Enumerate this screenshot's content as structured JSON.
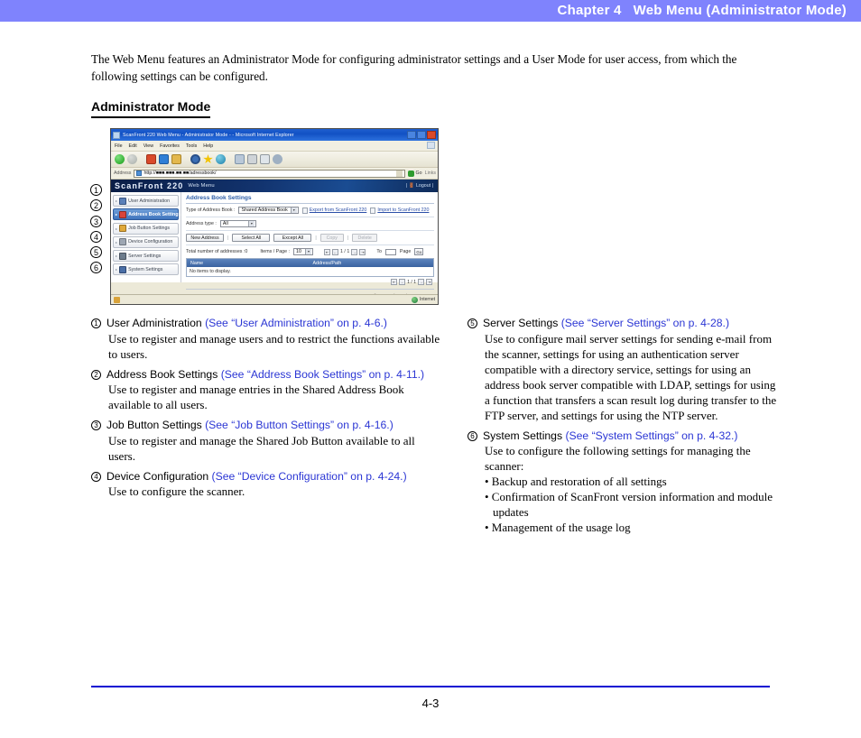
{
  "header": {
    "chapter_title": "Chapter 4   Web Menu (Administrator Mode)",
    "band_color": "#7f83fd"
  },
  "intro": {
    "paragraph": "The Web Menu features an Administrator Mode for configuring administrator settings and a User Mode for user access, from which the following settings can be configured."
  },
  "section": {
    "heading": "Administrator Mode"
  },
  "callouts": [
    "1",
    "2",
    "3",
    "4",
    "5",
    "6"
  ],
  "screenshot": {
    "titlebar": {
      "text": "ScanFront 220 Web Menu - Administrator Mode -  - Microsoft Internet Explorer",
      "minimize": "_",
      "maximize": "□",
      "close": "×"
    },
    "menubar": [
      "File",
      "Edit",
      "View",
      "Favorites",
      "Tools",
      "Help"
    ],
    "toolbar_icons": [
      "back-icon",
      "forward-icon",
      "stop-icon",
      "refresh-icon",
      "home-icon",
      "search-icon",
      "favorites-icon",
      "history-icon",
      "mail-icon",
      "print-icon",
      "edit-icon",
      "discuss-icon"
    ],
    "addressbar": {
      "label": "Address",
      "url": "http://■■■.■■■.■■.■■/adressbook/",
      "go_label": "Go",
      "links_label": "Links"
    },
    "banner": {
      "brand": "ScanFront 220",
      "subtitle": "Web Menu",
      "logout": "|  🚪 Logout  |"
    },
    "sidebar": [
      {
        "label": "User Administration",
        "icon": "user-icon",
        "active": false
      },
      {
        "label": "Address Book Settings",
        "icon": "address-book-icon",
        "active": true
      },
      {
        "label": "Job Button Settings",
        "icon": "job-button-icon",
        "active": false
      },
      {
        "label": "Device Configuration",
        "icon": "device-icon",
        "active": false
      },
      {
        "label": "Server Settings",
        "icon": "server-icon",
        "active": false
      },
      {
        "label": "System Settings",
        "icon": "system-icon",
        "active": false
      }
    ],
    "main": {
      "title": "Address Book Settings",
      "type_label": "Type of Address Book :",
      "type_value": "Shared Address Book",
      "export_link": "Export from ScanFront 220",
      "import_link": "Import to ScanFront 220",
      "address_type_label": "Address type :",
      "address_type_value": "All",
      "buttons": [
        "New Address",
        "Select All",
        "Except All",
        "Copy",
        "Delete"
      ],
      "total_label": "Total number of addresses :0",
      "items_per_page_label": "Items / Page :",
      "items_per_page_value": "10",
      "page_indicator": "1 / 1",
      "to_label": "To",
      "to_value": "",
      "page_label": "Page",
      "go_label": "Go",
      "grid_headers": [
        "Name",
        "Address/Path"
      ],
      "grid_empty": "No items to display.",
      "grid_page_indicator": "1 / 1",
      "copyright": "© Canon Electronics Inc. 2007"
    },
    "statusbar": {
      "zone": "Internet"
    }
  },
  "items_left": [
    {
      "num": "1",
      "title": "User Administration ",
      "ref": "(See “User Administration” on p. 4-6.)",
      "desc": "Use to register and manage users and to restrict the functions available to users."
    },
    {
      "num": "2",
      "title": "Address Book Settings ",
      "ref": "(See “Address Book Settings” on p. 4-11.)",
      "desc": "Use to register and manage entries in the Shared Address Book available to all users."
    },
    {
      "num": "3",
      "title": "Job Button Settings ",
      "ref": "(See “Job Button Settings” on p. 4-16.)",
      "desc": "Use to register and manage the Shared Job Button available to all users."
    },
    {
      "num": "4",
      "title": "Device Configuration ",
      "ref": "(See “Device Configuration” on p. 4-24.)",
      "desc": "Use to configure the scanner."
    }
  ],
  "items_right": [
    {
      "num": "5",
      "title": "Server Settings ",
      "ref": "(See “Server Settings” on p. 4-28.)",
      "desc": "Use to configure mail server settings for sending e-mail from the scanner, settings for using an authentication server compatible with a directory service, settings for using an address book server compatible with LDAP, settings for using a function that transfers a scan result log during transfer to the FTP server, and settings for using the NTP server."
    },
    {
      "num": "6",
      "title": "System Settings ",
      "ref": "(See “System Settings” on p. 4-32.)",
      "desc": "Use to configure the following settings for managing the scanner:",
      "bullets": [
        "• Backup and restoration of all settings",
        "• Confirmation of ScanFront version information and module updates",
        "• Management of the usage log"
      ]
    }
  ],
  "footer": {
    "page_number": "4-3",
    "rule_color": "#0a0ad2"
  }
}
